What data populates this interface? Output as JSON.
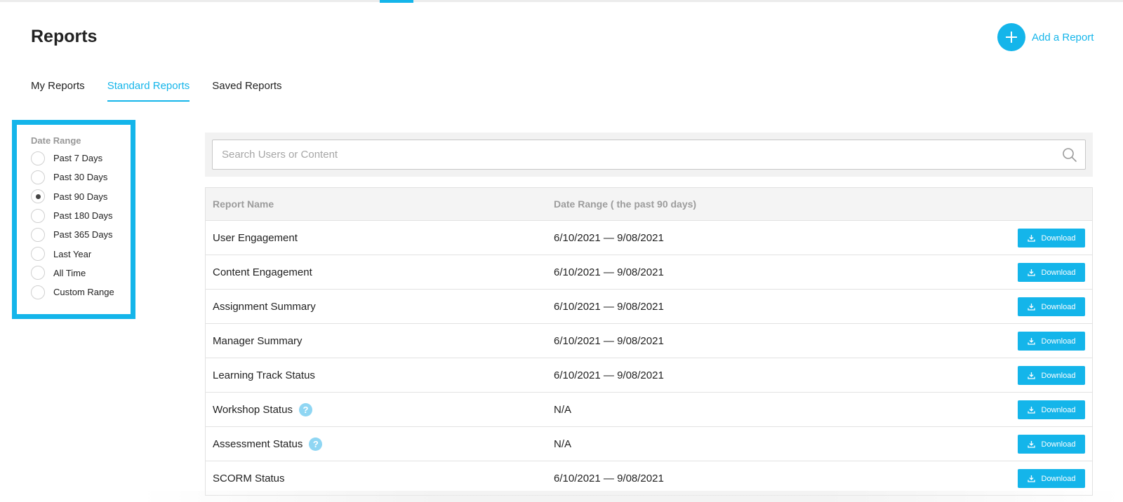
{
  "header": {
    "title": "Reports",
    "add_report_label": "Add a Report"
  },
  "tabs": [
    {
      "label": "My Reports",
      "active": false
    },
    {
      "label": "Standard Reports",
      "active": true
    },
    {
      "label": "Saved Reports",
      "active": false
    }
  ],
  "filter": {
    "title": "Date Range",
    "options": [
      {
        "label": "Past 7 Days",
        "checked": false
      },
      {
        "label": "Past 30 Days",
        "checked": false
      },
      {
        "label": "Past 90 Days",
        "checked": true
      },
      {
        "label": "Past 180 Days",
        "checked": false
      },
      {
        "label": "Past 365 Days",
        "checked": false
      },
      {
        "label": "Last Year",
        "checked": false
      },
      {
        "label": "All Time",
        "checked": false
      },
      {
        "label": "Custom Range",
        "checked": false
      }
    ]
  },
  "search": {
    "placeholder": "Search Users or Content",
    "value": ""
  },
  "table": {
    "headers": [
      "Report Name",
      "Date Range ( the past 90 days)"
    ],
    "download_label": "Download",
    "rows": [
      {
        "name": "User Engagement",
        "range": "6/10/2021 — 9/08/2021",
        "help": false
      },
      {
        "name": "Content Engagement",
        "range": "6/10/2021 — 9/08/2021",
        "help": false
      },
      {
        "name": "Assignment Summary",
        "range": "6/10/2021 — 9/08/2021",
        "help": false
      },
      {
        "name": "Manager Summary",
        "range": "6/10/2021 — 9/08/2021",
        "help": false
      },
      {
        "name": "Learning Track Status",
        "range": "6/10/2021 — 9/08/2021",
        "help": false
      },
      {
        "name": "Workshop Status",
        "range": "N/A",
        "help": true
      },
      {
        "name": "Assessment Status",
        "range": "N/A",
        "help": true
      },
      {
        "name": "SCORM Status",
        "range": "6/10/2021 — 9/08/2021",
        "help": false
      }
    ],
    "help_glyph": "?"
  },
  "colors": {
    "accent": "#14b5ea",
    "help_icon": "#8fd6f3",
    "header_text": "#9c9c9c"
  },
  "icons": {
    "add": "plus-icon",
    "search": "search-icon",
    "download": "download-icon",
    "help": "help-icon"
  }
}
